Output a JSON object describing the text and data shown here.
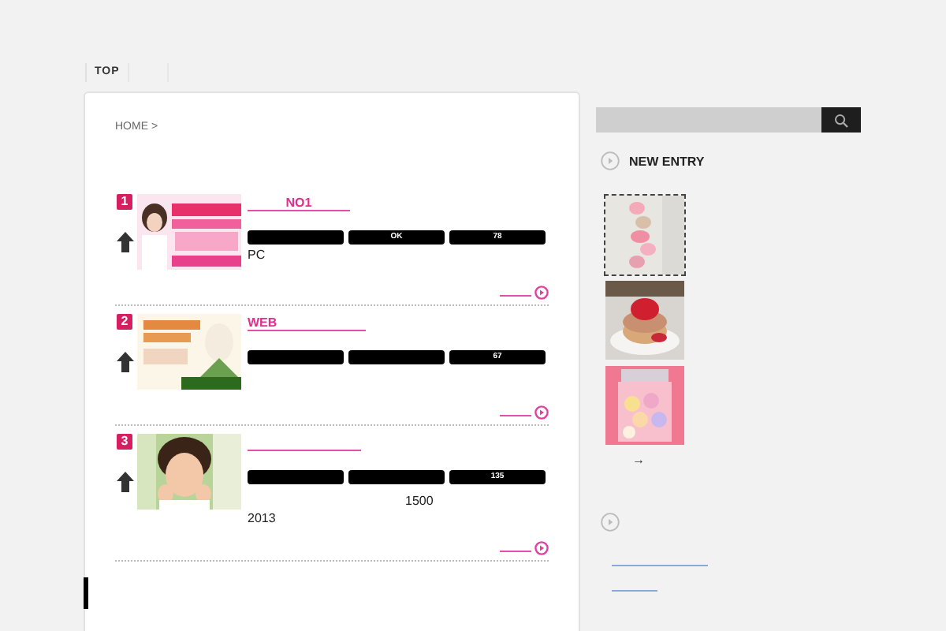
{
  "nav": {
    "tabs": [
      {
        "label": "TOP",
        "selected": false
      }
    ]
  },
  "breadcrumb": "HOME >",
  "entries": [
    {
      "rank": "1",
      "title": "NO1",
      "tags": [
        {
          "kind": "blank"
        },
        {
          "kind": "text",
          "text": "OK"
        },
        {
          "kind": "text",
          "text": "78"
        }
      ],
      "lines": [
        "PC"
      ],
      "picture": {
        "kind": "picture"
      }
    },
    {
      "rank": "2",
      "title": "WEB",
      "tags": [
        {
          "kind": "blank"
        },
        {
          "kind": "blank"
        },
        {
          "kind": "text",
          "text": "67"
        }
      ],
      "picture": {
        "kind": "picture"
      }
    },
    {
      "rank": "3",
      "tags": [
        {
          "kind": "blank"
        },
        {
          "kind": "blank"
        },
        {
          "kind": "text",
          "text": "135"
        }
      ],
      "lines": [
        "1500",
        "2013"
      ],
      "picture": {
        "kind": "picture"
      }
    }
  ],
  "sidebar": {
    "new_entry": {
      "heading": "NEW ENTRY",
      "thumbs": [
        {
          "kind": "picture",
          "selected": true
        },
        {
          "kind": "picture",
          "selected": false
        },
        {
          "kind": "picture",
          "selected": false
        }
      ],
      "more": "→"
    },
    "links": [
      {
        "kind": "long"
      },
      {
        "kind": "short"
      }
    ]
  }
}
